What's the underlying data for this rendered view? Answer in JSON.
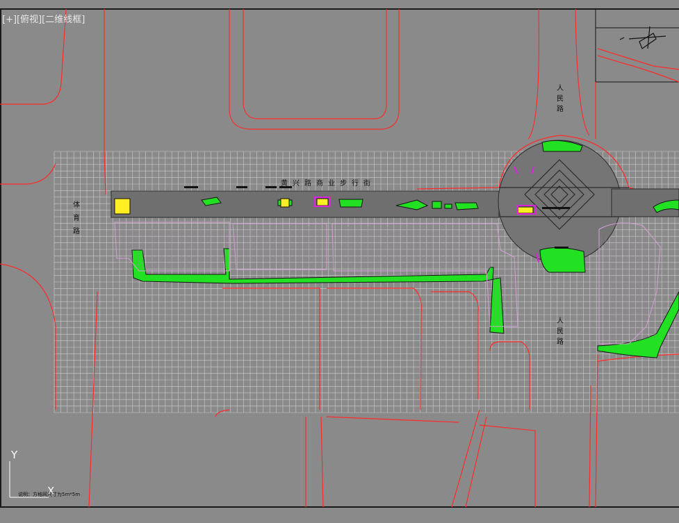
{
  "viewport": {
    "label": "[+][俯视][二维线框]"
  },
  "labels": {
    "street_title": "黄兴路商业步行街",
    "renmin_north": "人民路",
    "renmin_south": "人民路",
    "west_road": "体育路",
    "scale_note": "说明：方格网尺寸为5m*5m"
  },
  "axes": {
    "y": "Y",
    "x": "X"
  },
  "colors": {
    "background": "#8a8a8a",
    "road_lines": "#ff2a2a",
    "grid": "#d8d8d8",
    "green": "#22e022",
    "yellow": "#ffee22",
    "magenta": "#e020e0"
  },
  "icons": [
    "north-arrow-icon",
    "ucs-icon"
  ]
}
